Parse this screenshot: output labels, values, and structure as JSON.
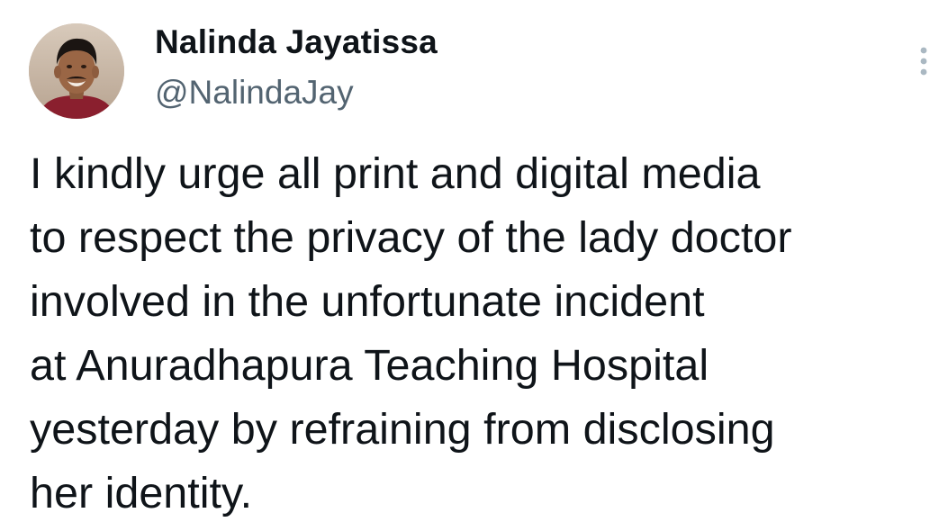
{
  "author": {
    "display_name": "Nalinda Jayatissa",
    "handle": "@NalindaJay",
    "avatar_icon": "profile-photo"
  },
  "more_menu": {
    "icon": "more-vertical-icon"
  },
  "tweet": {
    "lines": [
      "I kindly urge all print and digital media",
      "to respect the privacy of the lady doctor",
      "involved in the unfortunate incident",
      "at Anuradhapura Teaching Hospital",
      "yesterday by refraining from disclosing",
      "her identity."
    ]
  },
  "colors": {
    "text_primary": "#0f1419",
    "text_secondary": "#536471",
    "background": "#ffffff"
  }
}
